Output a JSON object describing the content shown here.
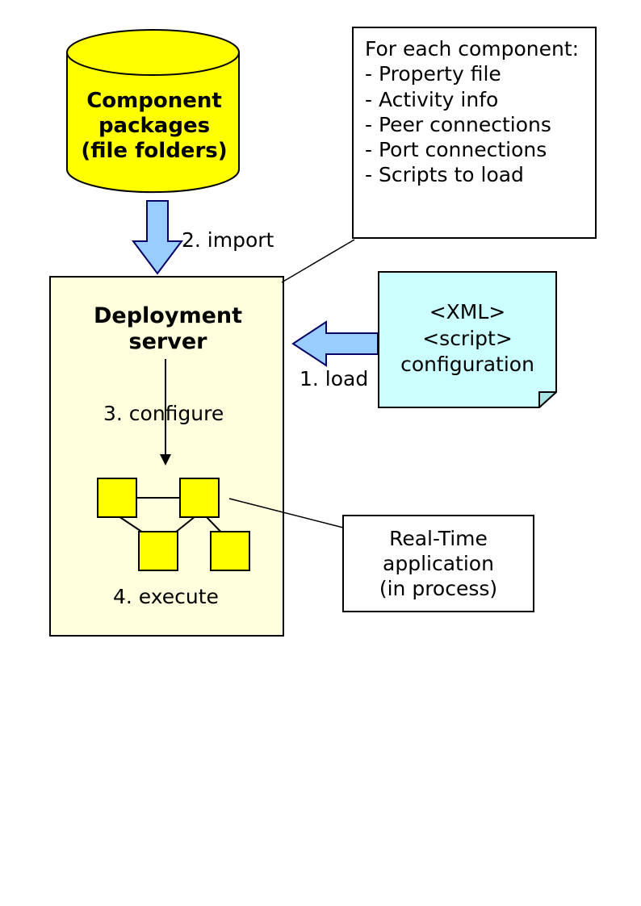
{
  "component_packages": {
    "line1": "Component",
    "line2": "packages",
    "line3": "(file folders)"
  },
  "steps": {
    "import": "2. import",
    "load": "1. load",
    "configure": "3. configure",
    "execute": "4. execute"
  },
  "deployment_server": {
    "line1": "Deployment",
    "line2": "server"
  },
  "foreach": {
    "title": "For each component:",
    "items": [
      "- Property file",
      "- Activity info",
      "- Peer connections",
      "- Port connections",
      "- Scripts to load"
    ]
  },
  "xml_note": {
    "line1": "<XML>",
    "line2": "<script>",
    "line3": "configuration"
  },
  "realtime": {
    "line1": "Real-Time",
    "line2": "application",
    "line3": "(in process)"
  },
  "colors": {
    "yellow": "#FFFF00",
    "box_fill": "#FFFFDD",
    "note_fill": "#CCFFFF",
    "arrow_fill": "#99CCFF"
  }
}
